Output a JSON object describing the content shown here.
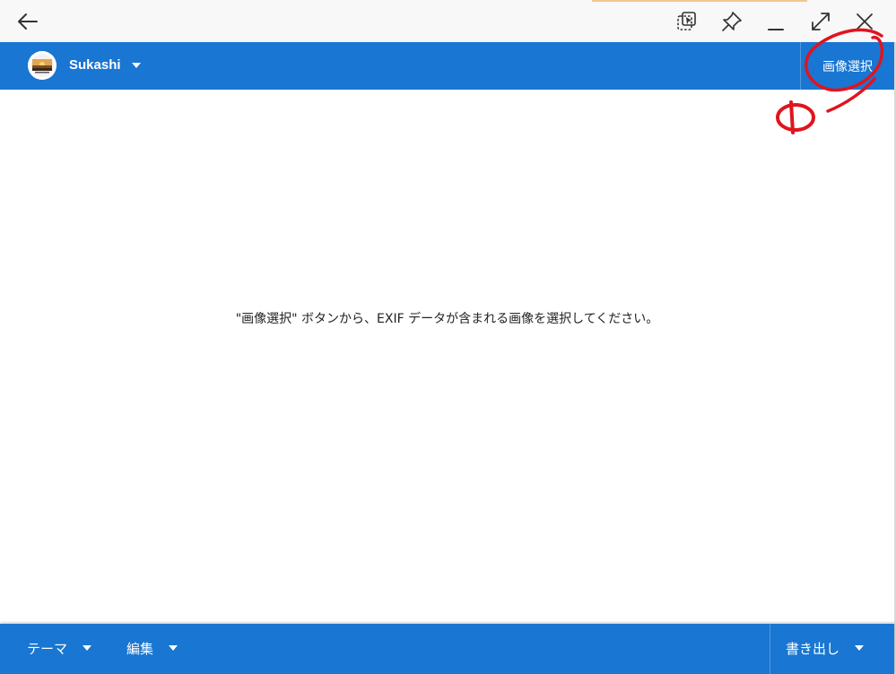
{
  "titlebar": {
    "icons": [
      "back-arrow-icon",
      "screenshot-select-icon",
      "pin-icon",
      "minimize-icon",
      "maximize-icon",
      "close-icon"
    ]
  },
  "appbar": {
    "account_name": "Sukashi",
    "select_image_label": "画像選択"
  },
  "content": {
    "message": "\"画像選択\" ボタンから、EXIF データが含まれる画像を選択してください。"
  },
  "bottombar": {
    "theme_label": "テーマ",
    "edit_label": "編集",
    "export_label": "書き出し"
  },
  "colors": {
    "primary": "#1976d2",
    "annotation": "#e0141e"
  }
}
